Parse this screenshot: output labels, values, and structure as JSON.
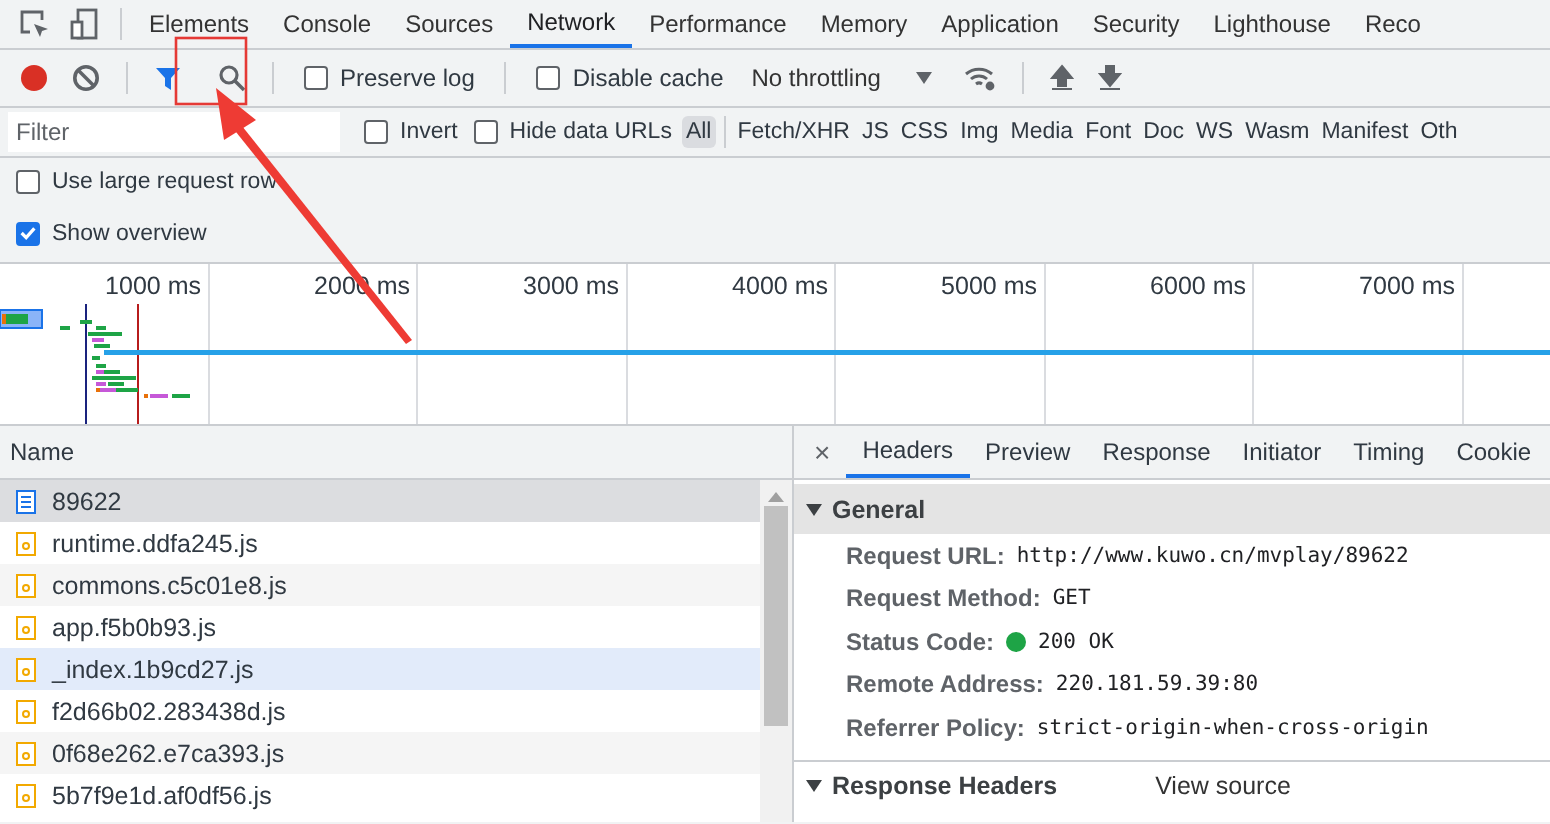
{
  "tabs": [
    {
      "label": "Elements",
      "selected": false
    },
    {
      "label": "Console",
      "selected": false
    },
    {
      "label": "Sources",
      "selected": false
    },
    {
      "label": "Network",
      "selected": true
    },
    {
      "label": "Performance",
      "selected": false
    },
    {
      "label": "Memory",
      "selected": false
    },
    {
      "label": "Application",
      "selected": false
    },
    {
      "label": "Security",
      "selected": false
    },
    {
      "label": "Lighthouse",
      "selected": false
    },
    {
      "label": "Reco",
      "selected": false
    }
  ],
  "toolbar": {
    "preserve_log": {
      "label": "Preserve log",
      "checked": false
    },
    "disable_cache": {
      "label": "Disable cache",
      "checked": false
    },
    "throttling": "No throttling"
  },
  "filter": {
    "placeholder": "Filter",
    "invert": {
      "label": "Invert",
      "checked": false
    },
    "hide_data_urls": {
      "label": "Hide data URLs",
      "checked": false
    },
    "types": [
      {
        "label": "All",
        "selected": true
      },
      {
        "label": "Fetch/XHR",
        "selected": false
      },
      {
        "label": "JS",
        "selected": false
      },
      {
        "label": "CSS",
        "selected": false
      },
      {
        "label": "Img",
        "selected": false
      },
      {
        "label": "Media",
        "selected": false
      },
      {
        "label": "Font",
        "selected": false
      },
      {
        "label": "Doc",
        "selected": false
      },
      {
        "label": "WS",
        "selected": false
      },
      {
        "label": "Wasm",
        "selected": false
      },
      {
        "label": "Manifest",
        "selected": false
      },
      {
        "label": "Oth",
        "selected": false
      }
    ]
  },
  "options": [
    {
      "label": "Use large request row",
      "checked": false
    },
    {
      "label": "Show overview",
      "checked": true
    }
  ],
  "overview": {
    "ticks": [
      "1000 ms",
      "2000 ms",
      "3000 ms",
      "4000 ms",
      "5000 ms",
      "6000 ms",
      "7000 ms"
    ]
  },
  "requests": {
    "column": "Name",
    "rows": [
      {
        "name": "89622",
        "kind": "document",
        "selected": true,
        "hovered": false
      },
      {
        "name": "runtime.ddfa245.js",
        "kind": "script",
        "selected": false,
        "hovered": false
      },
      {
        "name": "commons.c5c01e8.js",
        "kind": "script",
        "selected": false,
        "hovered": false
      },
      {
        "name": "app.f5b0b93.js",
        "kind": "script",
        "selected": false,
        "hovered": false
      },
      {
        "name": "_index.1b9cd27.js",
        "kind": "script",
        "selected": false,
        "hovered": true
      },
      {
        "name": "f2d66b02.283438d.js",
        "kind": "script",
        "selected": false,
        "hovered": false
      },
      {
        "name": "0f68e262.e7ca393.js",
        "kind": "script",
        "selected": false,
        "hovered": false
      },
      {
        "name": "5b7f9e1d.af0df56.js",
        "kind": "script",
        "selected": false,
        "hovered": false
      }
    ]
  },
  "details": {
    "close": "×",
    "tabs": [
      {
        "label": "Headers",
        "selected": true
      },
      {
        "label": "Preview",
        "selected": false
      },
      {
        "label": "Response",
        "selected": false
      },
      {
        "label": "Initiator",
        "selected": false
      },
      {
        "label": "Timing",
        "selected": false
      },
      {
        "label": "Cookie",
        "selected": false
      }
    ],
    "sections": [
      {
        "title": "General",
        "expanded": true,
        "fields": [
          {
            "label": "Request URL:",
            "value": "http://www.kuwo.cn/mvplay/89622"
          },
          {
            "label": "Request Method:",
            "value": "GET"
          },
          {
            "label": "Status Code:",
            "value": "200 OK",
            "color": "#1ea446"
          },
          {
            "label": "Remote Address:",
            "value": "220.181.59.39:80"
          },
          {
            "label": "Referrer Policy:",
            "value": "strict-origin-when-cross-origin"
          }
        ]
      },
      {
        "title": "Response Headers",
        "expanded": true,
        "action": "View source"
      }
    ]
  }
}
